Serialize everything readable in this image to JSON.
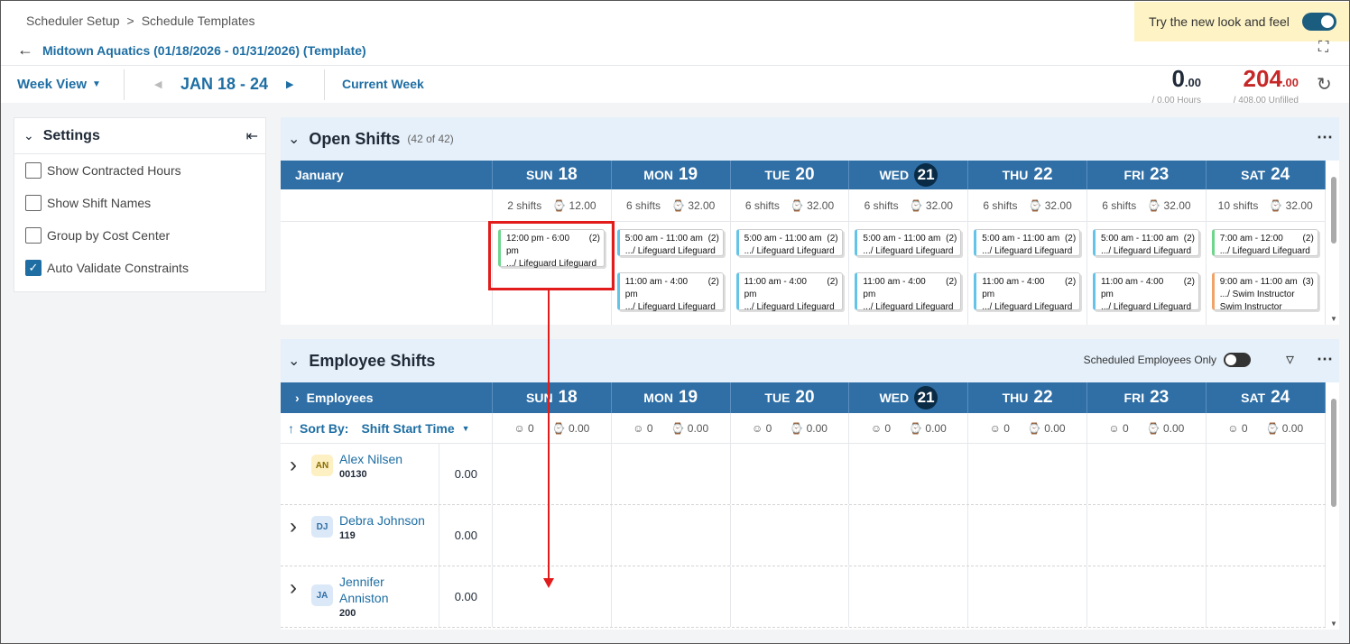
{
  "breadcrumb": {
    "item1": "Scheduler Setup",
    "sep": ">",
    "item2": "Schedule Templates"
  },
  "page_title": "Midtown Aquatics (01/18/2026 - 01/31/2026) (Template)",
  "promo": {
    "label": "Try the new look and feel"
  },
  "toolbar": {
    "view_label": "Week View",
    "date_range": "JAN 18 - 24",
    "current_week": "Current Week"
  },
  "stats": {
    "hours_int": "0",
    "hours_dec": ".00",
    "hours_sub": "/ 0.00 Hours",
    "unfilled_int": "204",
    "unfilled_dec": ".00",
    "unfilled_sub": "/ 408.00 Unfilled"
  },
  "colors": {
    "accent": "#1e6ea3",
    "header_blue": "#2f6fa6",
    "today": "#0a2b46",
    "unfilled": "#c62828",
    "highlight": "#e21b1b"
  },
  "settings": {
    "title": "Settings",
    "options": [
      {
        "label": "Show Contracted Hours",
        "checked": false
      },
      {
        "label": "Show Shift Names",
        "checked": false
      },
      {
        "label": "Group by Cost Center",
        "checked": false
      },
      {
        "label": "Auto Validate Constraints",
        "checked": true
      }
    ]
  },
  "open_shifts": {
    "title": "Open Shifts",
    "count": "(42 of 42)",
    "month": "January",
    "days": [
      {
        "dn": "SUN",
        "num": "18"
      },
      {
        "dn": "MON",
        "num": "19"
      },
      {
        "dn": "TUE",
        "num": "20"
      },
      {
        "dn": "WED",
        "num": "21",
        "today": true
      },
      {
        "dn": "THU",
        "num": "22"
      },
      {
        "dn": "FRI",
        "num": "23"
      },
      {
        "dn": "SAT",
        "num": "24"
      }
    ],
    "summary": [
      {
        "shifts": "2 shifts",
        "hours": "12.00"
      },
      {
        "shifts": "6 shifts",
        "hours": "32.00"
      },
      {
        "shifts": "6 shifts",
        "hours": "32.00"
      },
      {
        "shifts": "6 shifts",
        "hours": "32.00"
      },
      {
        "shifts": "6 shifts",
        "hours": "32.00"
      },
      {
        "shifts": "6 shifts",
        "hours": "32.00"
      },
      {
        "shifts": "10 shifts",
        "hours": "32.00"
      }
    ],
    "cards": [
      [
        {
          "time": "12:00 pm - 6:00",
          "time2": "pm",
          "qty": "(2)",
          "role": ".../ Lifeguard  Lifeguard",
          "color": "g"
        }
      ],
      [
        {
          "time": "5:00 am - 11:00 am",
          "qty": "(2)",
          "role": ".../ Lifeguard  Lifeguard",
          "color": "b"
        },
        {
          "time": "11:00 am - 4:00",
          "time2": "pm",
          "qty": "(2)",
          "role": ".../ Lifeguard  Lifeguard",
          "color": "b"
        }
      ],
      [
        {
          "time": "5:00 am - 11:00 am",
          "qty": "(2)",
          "role": ".../ Lifeguard  Lifeguard",
          "color": "b"
        },
        {
          "time": "11:00 am - 4:00",
          "time2": "pm",
          "qty": "(2)",
          "role": ".../ Lifeguard  Lifeguard",
          "color": "b"
        }
      ],
      [
        {
          "time": "5:00 am - 11:00 am",
          "qty": "(2)",
          "role": ".../ Lifeguard  Lifeguard",
          "color": "b"
        },
        {
          "time": "11:00 am - 4:00",
          "time2": "pm",
          "qty": "(2)",
          "role": ".../ Lifeguard  Lifeguard",
          "color": "b"
        }
      ],
      [
        {
          "time": "5:00 am - 11:00 am",
          "qty": "(2)",
          "role": ".../ Lifeguard  Lifeguard",
          "color": "b"
        },
        {
          "time": "11:00 am - 4:00",
          "time2": "pm",
          "qty": "(2)",
          "role": ".../ Lifeguard  Lifeguard",
          "color": "b"
        }
      ],
      [
        {
          "time": "5:00 am - 11:00 am",
          "qty": "(2)",
          "role": ".../ Lifeguard  Lifeguard",
          "color": "b"
        },
        {
          "time": "11:00 am - 4:00",
          "time2": "pm",
          "qty": "(2)",
          "role": ".../ Lifeguard  Lifeguard",
          "color": "b"
        }
      ],
      [
        {
          "time": "7:00 am - 12:00",
          "qty": "(2)",
          "role": ".../ Lifeguard  Lifeguard",
          "color": "g"
        },
        {
          "time": "9:00 am - 11:00 am",
          "qty": "(3)",
          "role": ".../ Swim Instructor",
          "role2": "Swim Instructor",
          "color": "o"
        }
      ]
    ]
  },
  "employee_shifts": {
    "title": "Employee Shifts",
    "scheduled_only": "Scheduled Employees Only",
    "employees_label": "Employees",
    "sort_by": "Sort By:",
    "sort_value": "Shift Start Time",
    "day_stats": [
      {
        "count": "0",
        "hours": "0.00"
      },
      {
        "count": "0",
        "hours": "0.00"
      },
      {
        "count": "0",
        "hours": "0.00"
      },
      {
        "count": "0",
        "hours": "0.00"
      },
      {
        "count": "0",
        "hours": "0.00"
      },
      {
        "count": "0",
        "hours": "0.00"
      },
      {
        "count": "0",
        "hours": "0.00"
      }
    ],
    "employees": [
      {
        "initials": "AN",
        "name": "Alex Nilsen",
        "id": "00130",
        "hours": "0.00",
        "bg": "#fdf0c2",
        "fg": "#8a6d00"
      },
      {
        "initials": "DJ",
        "name": "Debra Johnson",
        "id": "119",
        "hours": "0.00",
        "bg": "#dbe8f7",
        "fg": "#2f6fa6"
      },
      {
        "initials": "JA",
        "name": "Jennifer Anniston",
        "name_l1": "Jennifer",
        "name_l2": "Anniston",
        "id": "200",
        "hours": "0.00",
        "bg": "#dbe8f7",
        "fg": "#2f6fa6"
      }
    ]
  }
}
